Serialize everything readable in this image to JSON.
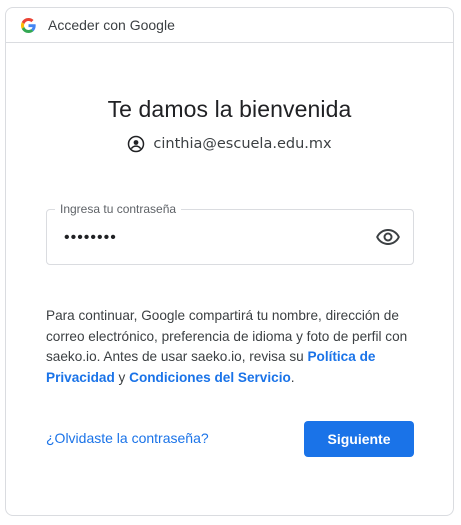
{
  "header": {
    "title": "Acceder con Google",
    "logo_icon": "google-g-icon"
  },
  "main": {
    "title": "Te damos la bienvenida",
    "account_email": "cinthia@escuela.edu.mx",
    "account_icon": "account-circle-icon"
  },
  "password_field": {
    "label": "Ingresa tu contraseña",
    "value": "••••••••",
    "toggle_icon": "eye-icon"
  },
  "info": {
    "text_before": "Para continuar, Google compartirá tu nombre, dirección de correo electrónico, preferencia de idioma y foto de perfil con saeko.io. Antes de usar saeko.io, revisa su ",
    "privacy_link": "Política de Privacidad",
    "and": " y ",
    "terms_link": "Condiciones del Servicio",
    "text_after": "."
  },
  "actions": {
    "forgot_label": "¿Olvidaste la contraseña?",
    "next_label": "Siguiente"
  },
  "colors": {
    "accent": "#1a73e8",
    "border": "#dadce0",
    "text": "#202124"
  }
}
